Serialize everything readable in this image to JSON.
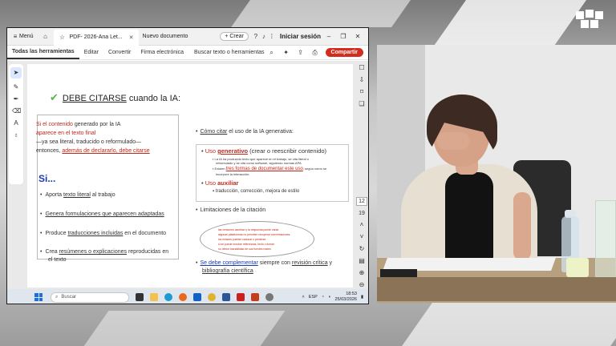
{
  "browser": {
    "menu_label": "Menú",
    "active_tab": "PDF- 2026-Ana Let...",
    "new_tab": "Nuevo documento",
    "create_label": "+ Crear",
    "signin_label": "Iniciar sesión"
  },
  "toolbar": {
    "tools": [
      "Todas las herramientas",
      "Editar",
      "Convertir",
      "Firma electrónica"
    ],
    "search_label": "Buscar texto o herramientas",
    "share_label": "Compartir"
  },
  "page_nav": {
    "current": "12",
    "total": "19"
  },
  "slide": {
    "title_prefix": "DEBE CITARSE",
    "title_suffix": " cuando la IA:",
    "intro_red1": "Si el contenido",
    "intro_rest1": " generado por la IA",
    "intro_red2": "aparece en el texto final",
    "intro_line3": "—ya sea literal, traducido o reformulado—",
    "intro_line4a": "entonces, ",
    "intro_line4b": "además de declararlo, debe citarse",
    "si_label": "Si...",
    "b1_a": "Aporta ",
    "b1_u": "texto literal",
    "b1_b": " al trabajo",
    "b2_u": "Genera formulaciones que aparecen adaptadas",
    "b3_a": "Produce ",
    "b3_u": "traducciones incluidas",
    "b3_b": " en el documento",
    "b4_a": "Crea ",
    "b4_u": "resúmenes o explicaciones",
    "b4_b": " reproducidas en",
    "b4_c": "el texto",
    "r_title_u": "Cómo citar",
    "r_title_b": " el uso de la IA generativa:",
    "gen_a": "Uso ",
    "gen_b": "generativo",
    "gen_c": " (crear o reescribir contenido)",
    "gen_sub1": "La IA ha producido texto que aparece en el trabajo, se cita literal o",
    "gen_sub1b": "reformulado y se cita como software, siguiendo normas APA",
    "gen_sub2a": "Existen ",
    "gen_sub2b": "tres formas de documentar este uso",
    "gen_sub2c": ", según cómo se",
    "gen_sub2d": "incorpore la interacción.",
    "aux_a": "Uso ",
    "aux_b": "auxiliar",
    "aux_sub": "traducción, corrección, mejora de estilo",
    "lim": "Limitaciones de la citación",
    "ell1": "las versiones cambian y la respuesta puede variar.",
    "ell2": "algunas plataformas no permiten recuperar conversaciones.",
    "ell3": "los enlaces pueden caducar o perderse.",
    "ell4": "si se puede mostrar referencias, texto o fuente.",
    "ell5": "no ofrece trazabilidad de sus fuentes reales.",
    "final_a": "Se debe complementar",
    "final_b": " siempre con ",
    "final_c": "revisión crítica",
    "final_d": " y",
    "final_e": "bibliografía científica"
  },
  "taskbar": {
    "search_placeholder": "Buscar",
    "lang": "ESP",
    "time": "18:53",
    "date": "25/03/2026"
  },
  "colors": {
    "accent_red": "#c0291c",
    "heading_blue": "#1b3bb0",
    "share_red": "#d32b1e",
    "check_green": "#5bb34a"
  }
}
